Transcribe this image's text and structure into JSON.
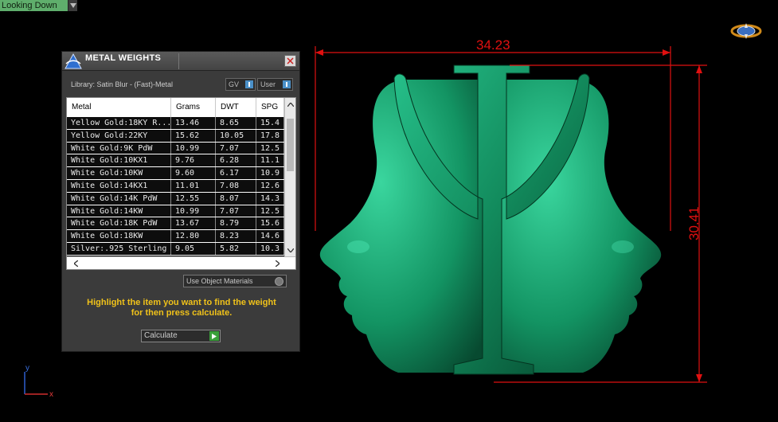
{
  "viewport": {
    "label": "Looking Down"
  },
  "dimensions": {
    "width": "34.23",
    "height": "30.41",
    "color": "#e01010"
  },
  "axis": {
    "y": "y",
    "x": "x"
  },
  "dialog": {
    "title": "METAL WEIGHTS",
    "library": "Library: Satin Blur - (Fast)-Metal",
    "toggle_gv": "GV",
    "toggle_user": "User",
    "columns": [
      "Metal",
      "Grams",
      "DWT",
      "SPG"
    ],
    "rows": [
      [
        "Yellow Gold:18KY R...",
        "13.46",
        "8.65",
        "15.4"
      ],
      [
        "Yellow Gold:22KY",
        "15.62",
        "10.05",
        "17.8"
      ],
      [
        "White Gold:9K PdW",
        "10.99",
        "7.07",
        "12.5"
      ],
      [
        "White Gold:10KX1",
        "9.76",
        "6.28",
        "11.1"
      ],
      [
        "White Gold:10KW",
        "9.60",
        "6.17",
        "10.9"
      ],
      [
        "White Gold:14KX1",
        "11.01",
        "7.08",
        "12.6"
      ],
      [
        "White Gold:14K PdW",
        "12.55",
        "8.07",
        "14.3"
      ],
      [
        "White Gold:14KW",
        "10.99",
        "7.07",
        "12.5"
      ],
      [
        "White Gold:18K PdW",
        "13.67",
        "8.79",
        "15.6"
      ],
      [
        "White Gold:18KW",
        "12.80",
        "8.23",
        "14.6"
      ],
      [
        "Silver:.925 Sterling",
        "9.05",
        "5.82",
        "10.3"
      ]
    ],
    "use_object_materials": "Use Object Materials",
    "hint_line1": "Highlight the item you want to find the weight",
    "hint_line2": "for then press calculate.",
    "calculate": "Calculate"
  },
  "colors": {
    "model": "#159a6a",
    "accent_green": "#5fae6c",
    "hint": "#f0c21a"
  }
}
